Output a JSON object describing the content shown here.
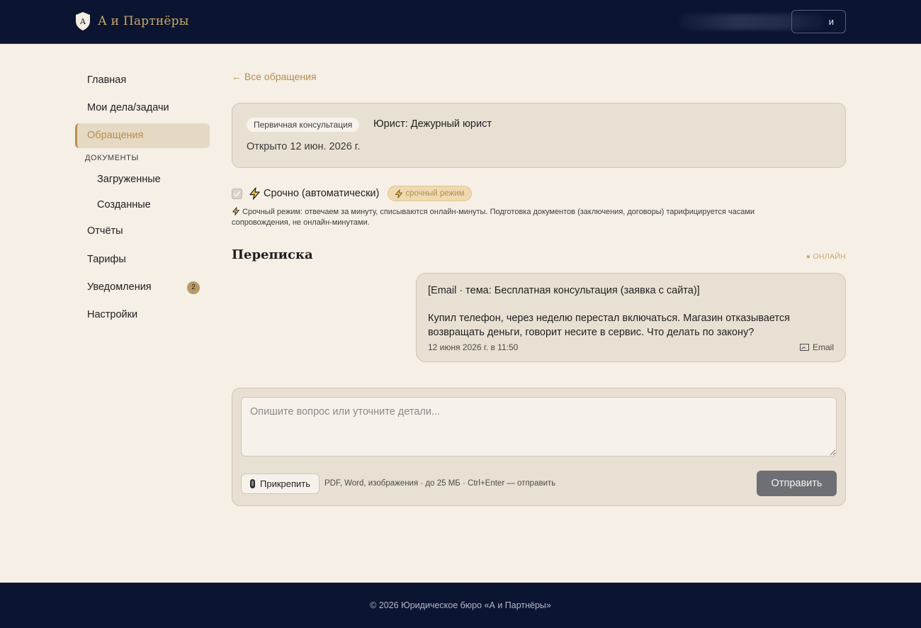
{
  "header": {
    "brand_name": "А и Партнёры",
    "user_button_label": "и"
  },
  "sidebar": {
    "items": [
      {
        "label": "Главная"
      },
      {
        "label": "Мои дела/задачи"
      },
      {
        "label": "Обращения",
        "active": true
      }
    ],
    "section_label": "ДОКУМЕНТЫ",
    "sub_items": [
      {
        "label": "Загруженные"
      },
      {
        "label": "Созданные"
      }
    ],
    "items_after": [
      {
        "label": "Отчёты"
      },
      {
        "label": "Тарифы"
      },
      {
        "label": "Уведомления",
        "badge": "2"
      },
      {
        "label": "Настройки"
      }
    ]
  },
  "main": {
    "back_link": "← Все обращения",
    "case": {
      "type_pill": "Первичная консультация",
      "lawyer": "Юрист: Дежурный юрист",
      "opened": "Открыто 12 июн. 2026 г."
    },
    "urgent": {
      "label": "Срочно (автоматически)",
      "checked": true,
      "pill": "срочный режим",
      "note": "Срочный режим: отвечаем за минуту, списываются онлайн-минуты. Подготовка документов (заключения, договоры) тарифицируется часами сопровождения, не онлайн-минутами."
    },
    "correspondence": {
      "title": "Переписка",
      "status": "● ОНЛАЙН",
      "message": {
        "subject": "[Email · тема: Бесплатная консультация (заявка с сайта)]",
        "body": "Купил телефон, через неделю перестал включаться. Магазин отказывается возвращать деньги, говорит несите в сервис. Что делать по закону?",
        "time": "12 июня 2026 г. в 11:50",
        "channel": "Email"
      }
    },
    "composer": {
      "placeholder": "Опишите вопрос или уточните детали...",
      "attach_label": "Прикрепить",
      "hint": "PDF, Word, изображения · до 25 МБ · Ctrl+Enter — отправить",
      "send_label": "Отправить"
    }
  },
  "footer": {
    "copyright": "© 2026 Юридическое бюро «А и Партнёры»"
  },
  "colors": {
    "header_bg": "#0b1430",
    "page_bg": "#f5efe6",
    "card_bg": "#e8e0d2",
    "accent": "#b58e52",
    "send_button": "#6e6f74"
  },
  "icons": {
    "logo": "shield-monogram-icon",
    "urgent": "lightning-icon",
    "channel": "email-icon",
    "attach": "paperclip-icon"
  }
}
